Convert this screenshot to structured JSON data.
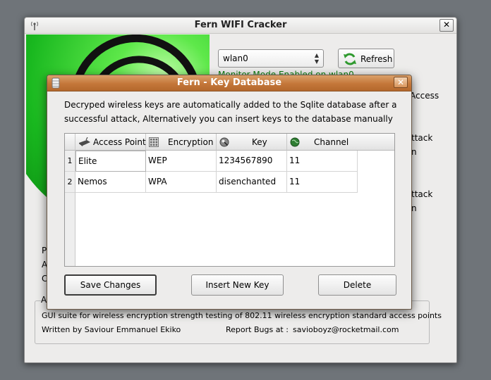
{
  "main_window": {
    "title": "Fern WIFI Cracker",
    "close_label": "✕",
    "interface_select": {
      "value": "wlan0"
    },
    "refresh_label": "Refresh",
    "monitor_status": "Monitor Mode Enabled on wlan0",
    "partial_labels": {
      "access": "Access",
      "attack_1": "ttack",
      "attack_1_sub": "n",
      "attack_2": "ttack",
      "attack_2_sub": "n",
      "left_p": "P",
      "left_a": "A",
      "left_c": "C",
      "about_a": "A"
    },
    "about": {
      "description": "GUI suite for wireless  encryption strength testing of 802.11 wireless encryption standard access points",
      "author": "Written by Saviour Emmanuel Ekiko",
      "report_label": "Report Bugs at :",
      "email": "savioboyz@rocketmail.com"
    },
    "icons": {
      "title": "wifi-icon",
      "refresh": "refresh-icon",
      "logo": "fern-logo"
    },
    "colors": {
      "logo_green": "#22c22a",
      "status_green": "#0a7a0a"
    }
  },
  "dialog": {
    "title": "Fern - Key Database",
    "close_label": "✕",
    "description": "Decryped wireless keys are automatically added to the Sqlite database after a successful attack, Alternatively you can insert keys to the database manually",
    "columns": [
      {
        "label": "Access Point",
        "icon": "router-icon"
      },
      {
        "label": "Encryption",
        "icon": "keypad-icon"
      },
      {
        "label": "Key",
        "icon": "key-icon"
      },
      {
        "label": "Channel",
        "icon": "globe-icon"
      }
    ],
    "rows": [
      {
        "num": "1",
        "access_point": "Elite",
        "encryption": "WEP",
        "key": "1234567890",
        "channel": "11"
      },
      {
        "num": "2",
        "access_point": "Nemos",
        "encryption": "WPA",
        "key": "disenchanted",
        "channel": "11"
      }
    ],
    "buttons": {
      "save": "Save Changes",
      "insert": "Insert New Key",
      "delete": "Delete"
    },
    "colors": {
      "titlebar": "#c4773a"
    }
  }
}
